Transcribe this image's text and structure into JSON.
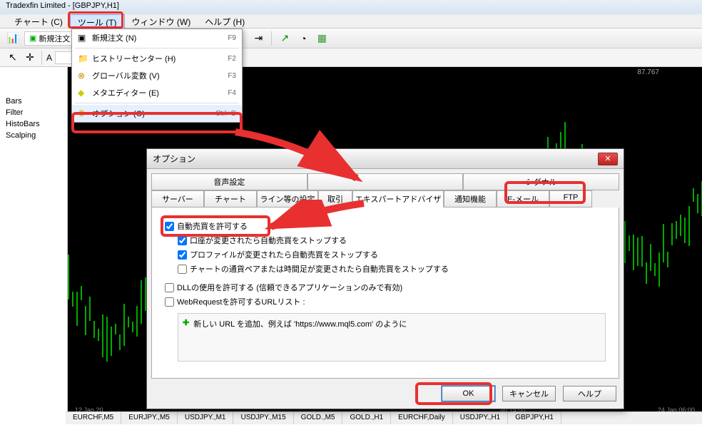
{
  "title": "Tradexfin Limited - [GBPJPY,H1]",
  "menu": {
    "chart": "チャート (C)",
    "tools": "ツール (T)",
    "window": "ウィンドウ (W)",
    "help": "ヘルプ (H)"
  },
  "toolbar": {
    "newOrder": "新規注文"
  },
  "sidebar": {
    "items": [
      "Bars",
      "Filter",
      "HistoBars",
      "Scalping"
    ]
  },
  "chart": {
    "rate": "87.767",
    "t1": "12 Jan 20",
    "t2": "an 14:00",
    "t3": "24 Jan 06:00"
  },
  "dropdown": {
    "newOrder": {
      "label": "新規注文 (N)",
      "shortcut": "F9"
    },
    "history": {
      "label": "ヒストリーセンター (H)",
      "shortcut": "F2"
    },
    "global": {
      "label": "グローバル変数 (V)",
      "shortcut": "F3"
    },
    "meta": {
      "label": "メタエディター (E)",
      "shortcut": "F4"
    },
    "options": {
      "label": "オプション (O)",
      "shortcut": "Ctrl+O"
    }
  },
  "dialog": {
    "title": "オプション",
    "tabs1": [
      "音声設定",
      "",
      "シグナル"
    ],
    "tabs2": [
      "サーバー",
      "チャート",
      "ライン等の設定",
      "取引",
      "エキスパートアドバイザ",
      "通知機能",
      "E-メール",
      "FTP"
    ],
    "checks": {
      "allow": "自動売買を許可する",
      "stopAccount": "口座が変更されたら自動売買をストップする",
      "stopProfile": "プロファイルが変更されたら自動売買をストップする",
      "stopChart": "チャートの通貨ペアまたは時間足が変更されたら自動売買をストップする",
      "dll": "DLLの使用を許可する (信頼できるアプリケーションのみで有効)",
      "web": "WebRequestを許可するURLリスト :"
    },
    "urlHint": "新しい URL を追加、例えば 'https://www.mql5.com' のように",
    "buttons": {
      "ok": "OK",
      "cancel": "キャンセル",
      "help": "ヘルプ"
    }
  },
  "statusTabs": [
    "EURCHF,M5",
    "EURJPY.,M5",
    "USDJPY.,M1",
    "USDJPY.,M15",
    "GOLD.,M5",
    "GOLD.,H1",
    "EURCHF,Daily",
    "USDJPY.,H1",
    "GBPJPY,H1"
  ]
}
